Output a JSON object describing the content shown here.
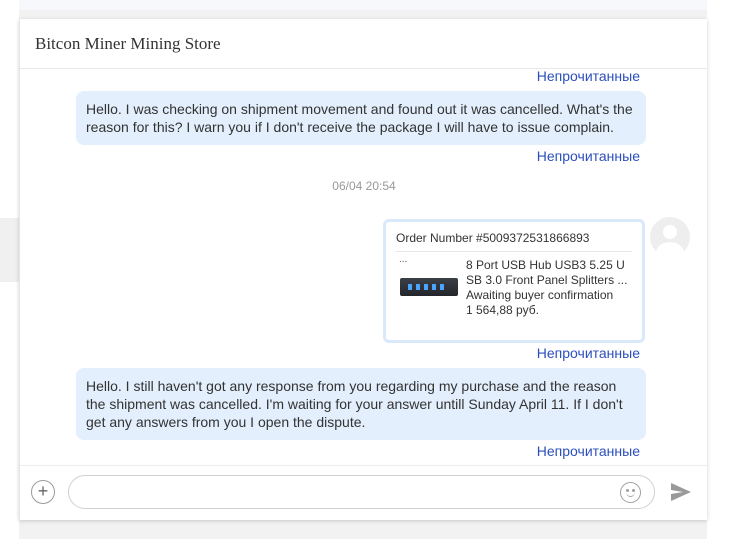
{
  "chat": {
    "title": "Bitcon Miner Mining Store"
  },
  "messages": {
    "status_label": "Непрочитанные",
    "message1": "Hello. I was checking on shipment movement and found out it was cancelled. What's the reason for this? I warn you if I don't receive the package I will have to issue complain.",
    "timestamp": "06/04 20:54",
    "order": {
      "number": "Order Number #5009372531866893",
      "thumb_caption": "...",
      "product_line1": "8 Port USB Hub USB3 5.25 U",
      "product_line2": "SB 3.0 Front Panel Splitters ...",
      "status": "Awaiting buyer confirmation",
      "price": "1 564,88 руб."
    },
    "message2": "Hello. I still haven't got any response from you regarding my purchase and the reason the shipment was cancelled. I'm waiting for  your answer untill Sunday April 11. If I don't get any answers from you I open the dispute."
  },
  "composer": {
    "value": "",
    "placeholder": "",
    "add_icon": "plus-icon",
    "emoji_icon": "smiley-icon",
    "send_icon": "send-icon"
  },
  "colors": {
    "bubble": "#e3effc",
    "status_link": "#2b4fbd",
    "card_border": "#d9e8fb"
  }
}
